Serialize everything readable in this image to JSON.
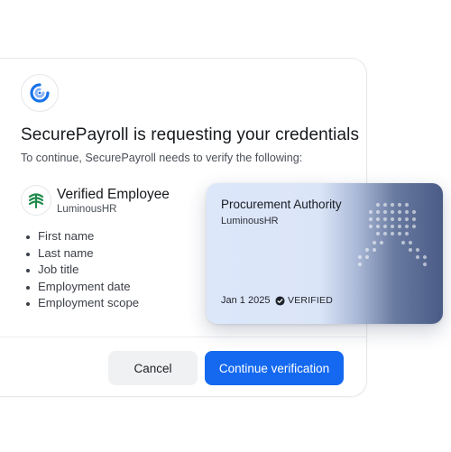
{
  "dialog": {
    "app_logo_icon": "app-logo-icon",
    "title": "SecurePayroll is requesting your credentials",
    "subtitle": "To continue, SecurePayroll needs to verify the following:",
    "issuer": {
      "icon": "luminoushr-logo-icon",
      "name": "Verified Employee",
      "org": "LuminousHR"
    },
    "fields": [
      "First name",
      "Last name",
      "Job title",
      "Employment date",
      "Employment scope"
    ],
    "buttons": {
      "cancel_label": "Cancel",
      "continue_label": "Continue verification"
    },
    "colors": {
      "primary": "#1469f0",
      "logo_blue": "#1a73e8",
      "issuer_green": "#1f8a4c"
    }
  },
  "card": {
    "title": "Procurement Authority",
    "org": "LuminousHR",
    "date": "Jan 1 2025",
    "status": "VERIFIED",
    "status_icon": "check-circle-icon",
    "emblem_icon": "award-ribbon-icon",
    "colors": {
      "light": "#dde7fa",
      "dark": "#4a5c86"
    }
  }
}
